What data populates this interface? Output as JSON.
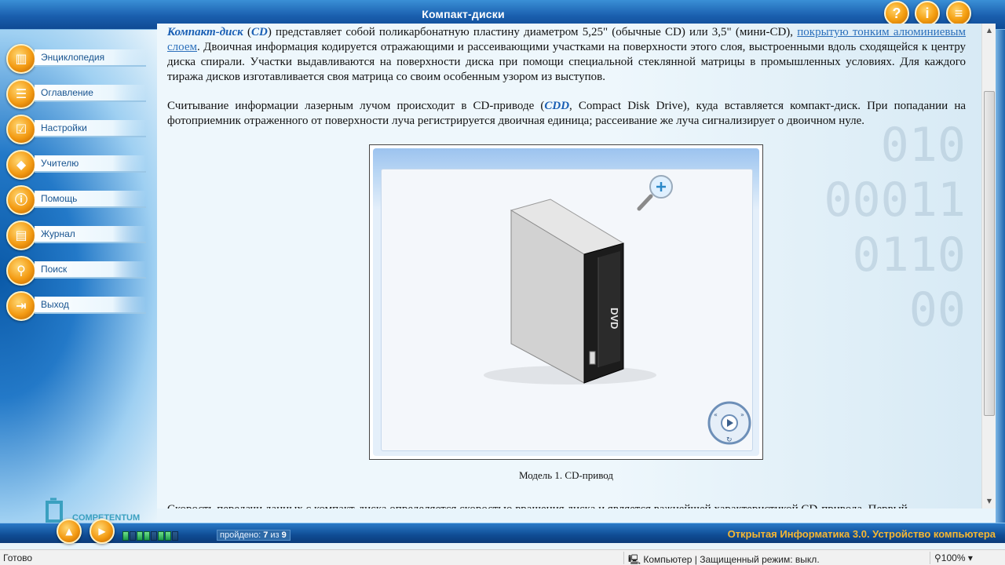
{
  "window": {
    "title": "Компакт-диски"
  },
  "top_buttons": [
    {
      "icon": "help-icon",
      "glyph": "?"
    },
    {
      "icon": "info-icon",
      "glyph": "i"
    },
    {
      "icon": "menu-icon",
      "glyph": "≡"
    }
  ],
  "sidebar": {
    "items": [
      {
        "label": "Энциклопедия",
        "icon": "book-icon",
        "glyph": "📖"
      },
      {
        "label": "Оглавление",
        "icon": "list-icon",
        "glyph": "☰"
      },
      {
        "label": "Настройки",
        "icon": "checkbox-icon",
        "glyph": "☑"
      },
      {
        "label": "Учителю",
        "icon": "graduation-cap-icon",
        "glyph": "🎓"
      },
      {
        "label": "Помощь",
        "icon": "help-book-icon",
        "glyph": "❓"
      },
      {
        "label": "Журнал",
        "icon": "journal-icon",
        "glyph": "📋"
      },
      {
        "label": "Поиск",
        "icon": "search-icon",
        "glyph": "🔍"
      },
      {
        "label": "Выход",
        "icon": "exit-icon",
        "glyph": "⇥"
      }
    ]
  },
  "content": {
    "p1": {
      "kw1": "Компакт-диск",
      "t1": " (",
      "kw2": "CD",
      "t2": ") представляет собой поликарбонатную пластину диаметром 5,25\" (обычные CD) или 3,5\" (мини-CD), ",
      "link": "покрытую тонким алюминиевым слоем",
      "t3": ". Двоичная информация кодируется отражающими и рассеивающими участками на поверхности этого слоя, выстроенными вдоль сходящейся к центру диска спирали. Участки выдавливаются на поверхности диска при помощи специальной стеклянной матрицы в промышленных условиях. Для каждого тиража дисков изготавливается своя матрица со своим особенным узором из выступов."
    },
    "p2": {
      "t1": "Считывание информации лазерным лучом происходит в CD-приводе (",
      "kw": "CDD",
      "t2": ", Compact Disk Drive), куда вставляется компакт-диск. При попадании на фотоприемник отраженного от поверхности луча регистрируется двоичная единица; рассеивание же луча сигнализирует о двоичном нуле."
    },
    "model_caption": "Модель 1. CD-привод",
    "drive_label": "DVD",
    "p3_cut": "Скорость передачи данных с компакт-диска определяется скоростью вращения диска и является важнейшей характеристикой CD-привода. Первый"
  },
  "bottom": {
    "passed_label": "пройдено:",
    "passed_current": "7",
    "passed_of": "из",
    "passed_total": "9",
    "course_title": "Открытая Информатика 3.0. Устройство компьютера",
    "logo_text": "COMPETENTUM"
  },
  "statusbar": {
    "left": "Готово",
    "zone": "Компьютер | Защищенный режим: выкл.",
    "zoom": "100%"
  }
}
